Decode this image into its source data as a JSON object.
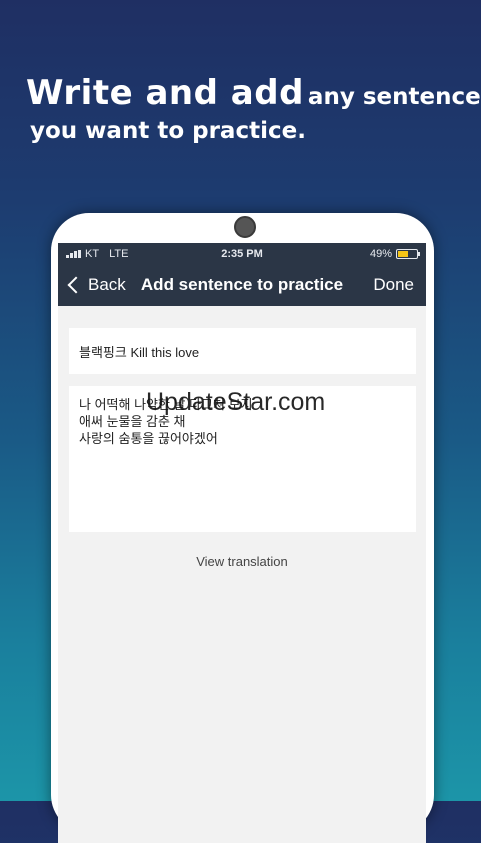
{
  "headline": {
    "big_text": "Write and add",
    "small_text": "any sentence",
    "line2": "you want to practice."
  },
  "status_bar": {
    "carrier": "KT",
    "network": "LTE",
    "time": "2:35 PM",
    "battery_percent": "49%",
    "battery_level": 0.49,
    "battery_color": "#f5c518"
  },
  "nav": {
    "back_label": "Back",
    "title": "Add sentence to practice",
    "done_label": "Done"
  },
  "form": {
    "title_value": "블랙핑크 Kill this love",
    "body_value": "나 어떡해 나약한 날 다그쳐 보지\n애써 눈물을 감춘 채\n사랑의 숨통을 끊어야겠어",
    "view_translation_label": "View translation"
  },
  "watermark": "UpdateStar.com",
  "colors": {
    "navbar": "#2b3646",
    "screen_bg": "#f2f2f2"
  }
}
